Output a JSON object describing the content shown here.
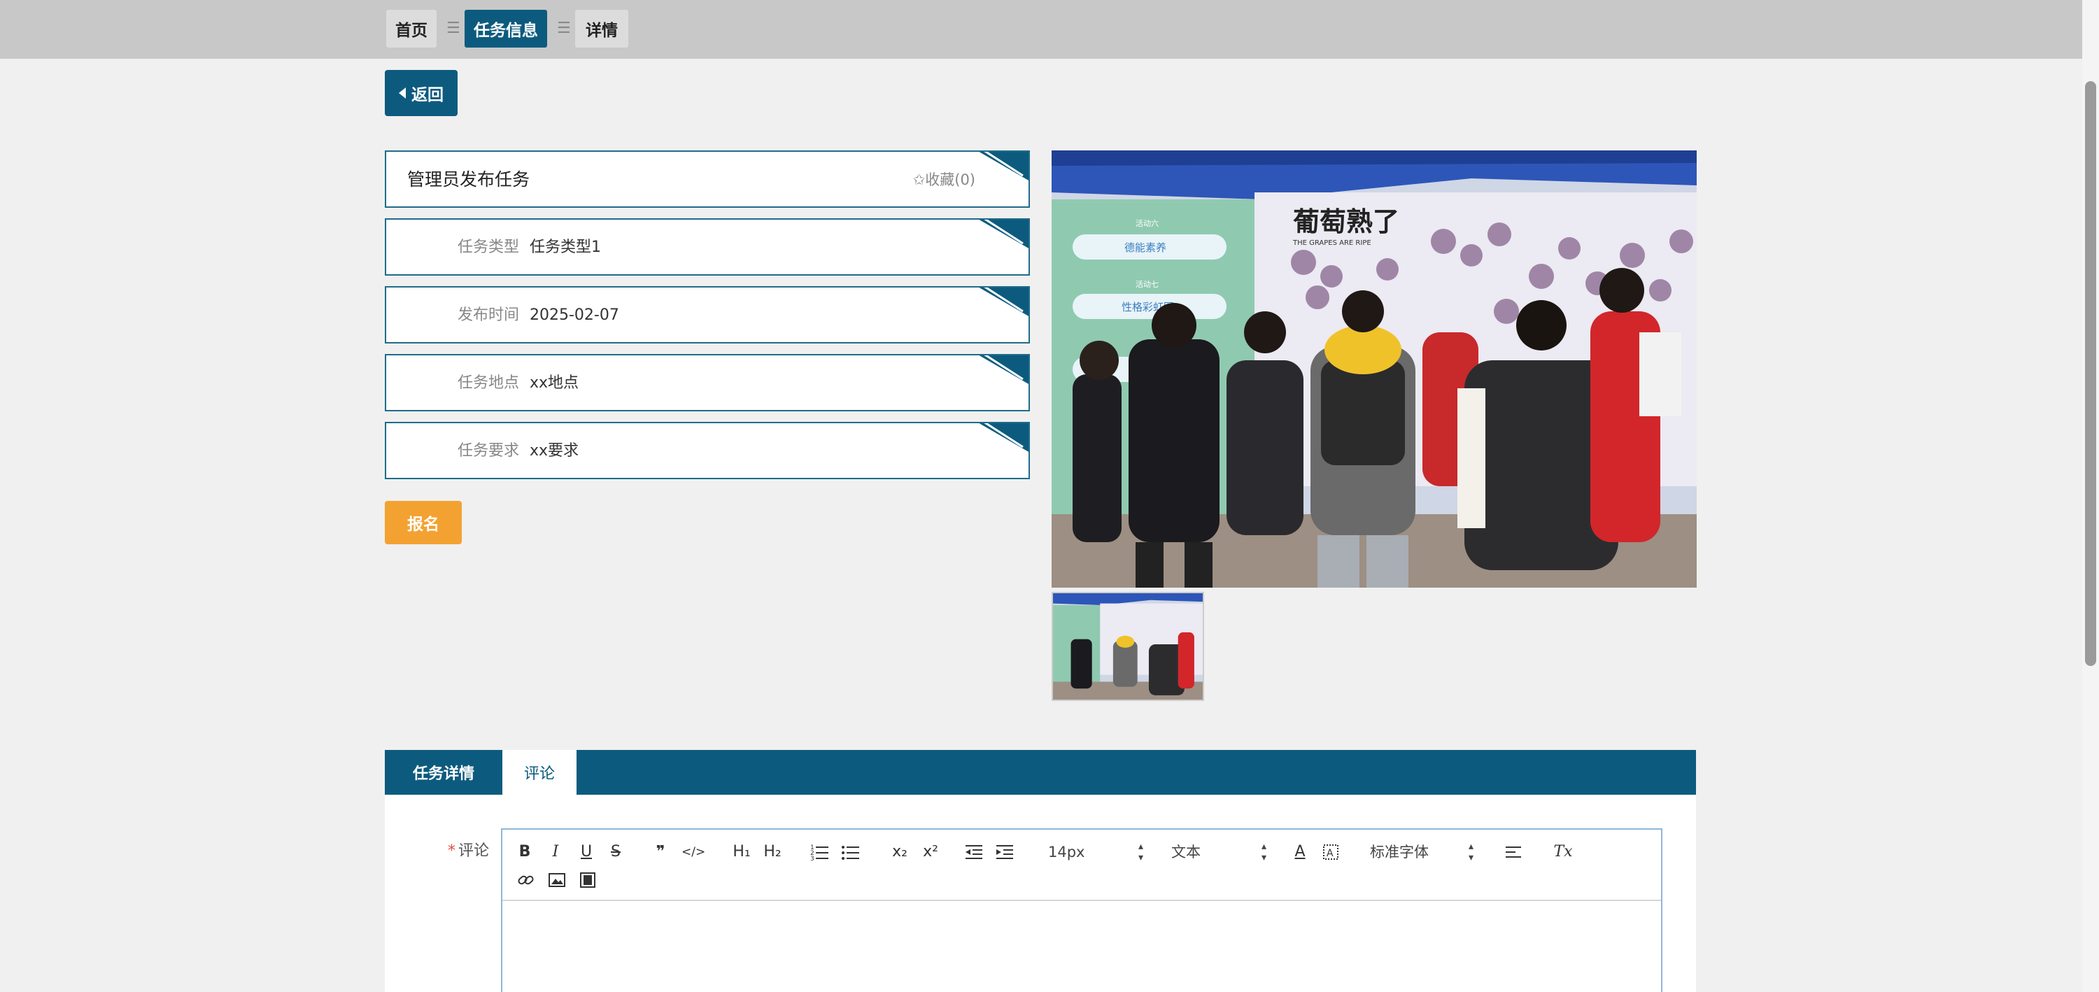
{
  "breadcrumb": {
    "home": "首页",
    "separator": "☰",
    "task_info": "任务信息",
    "detail": "详情"
  },
  "back_button": {
    "label": "返回"
  },
  "task": {
    "title": "管理员发布任务",
    "favorite": "✩收藏(0)",
    "fields": [
      {
        "label": "任务类型",
        "value": "任务类型1"
      },
      {
        "label": "发布时间",
        "value": "2025-02-07"
      },
      {
        "label": "任务地点",
        "value": "xx地点"
      },
      {
        "label": "任务要求",
        "value": "xx要求"
      }
    ]
  },
  "signup_button": {
    "label": "报名"
  },
  "photo": {
    "banner_text": "葡萄熟了",
    "banner_sub": "THE GRAPES ARE RIPE",
    "sign1_small": "活动六",
    "sign1": "德能素养",
    "sign2_small": "活动七",
    "sign2": "性格彩虹图"
  },
  "tabs": {
    "detail": "任务详情",
    "comment": "评论"
  },
  "comment": {
    "label": "评论",
    "required_mark": "*"
  },
  "editor": {
    "font_size": "14px",
    "text_type": "文本",
    "font_family": "标准字体",
    "buttons": {
      "bold": "B",
      "italic": "I",
      "underline": "U",
      "strike": "S",
      "quote": "❞",
      "code": "</>",
      "h1": "H₁",
      "h2": "H₂",
      "sub": "x₂",
      "sup": "x²",
      "color": "A",
      "clear": "Tx"
    }
  },
  "colors": {
    "primary": "#0c5b7e",
    "accent": "#f3a232",
    "border": "#1f6c89"
  }
}
